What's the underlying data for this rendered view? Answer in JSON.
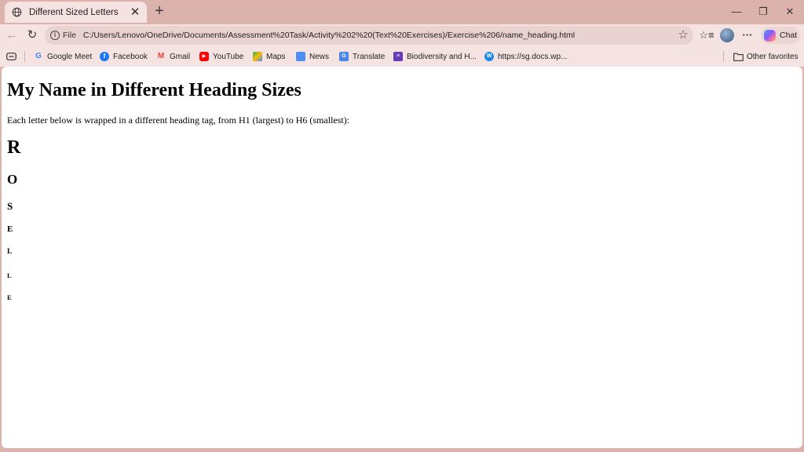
{
  "tab": {
    "title": "Different Sized Letters",
    "close_glyph": "✕",
    "icon": "globe-icon"
  },
  "new_tab_glyph": "+",
  "window_controls": {
    "minimize": "—",
    "restore": "❐",
    "close": "✕"
  },
  "toolbar": {
    "back_glyph": "←",
    "refresh_glyph": "↻",
    "scheme": "File",
    "url": "C:/Users/Lenovo/OneDrive/Documents/Assessment%20Task/Activity%202%20(Text%20Exercises)/Exercise%206/name_heading.html",
    "favorite_glyph": "☆",
    "favorites_glyph": "☆≡",
    "more_glyph": "···",
    "chat_label": "Chat"
  },
  "favorites": [
    {
      "label": "Google Meet",
      "icon": "google-icon",
      "color": "#4285f4"
    },
    {
      "label": "Facebook",
      "icon": "facebook-icon",
      "color": "#1877f2"
    },
    {
      "label": "Gmail",
      "icon": "gmail-icon",
      "color": "#ea4335"
    },
    {
      "label": "YouTube",
      "icon": "youtube-icon",
      "color": "#ff0000"
    },
    {
      "label": "Maps",
      "icon": "maps-icon",
      "color": "#34a853"
    },
    {
      "label": "News",
      "icon": "news-icon",
      "color": "#4f8ef7"
    },
    {
      "label": "Translate",
      "icon": "translate-icon",
      "color": "#4a86e8"
    },
    {
      "label": "Biodiversity and H...",
      "icon": "biodiversity-icon",
      "color": "#673ab7"
    },
    {
      "label": "https://sg.docs.wp...",
      "icon": "docs-icon",
      "color": "#1e88e5"
    }
  ],
  "other_favorites": "Other favorites",
  "page": {
    "heading": "My Name in Different Heading Sizes",
    "intro": "Each letter below is wrapped in a different heading tag, from H1 (largest) to H6 (smallest):",
    "letters": [
      "R",
      "O",
      "S",
      "E",
      "L",
      "L",
      "E"
    ]
  },
  "colors": {
    "frame": "#dcb2ad",
    "toolbar": "#f4e3e1",
    "address_bar": "#e9d3d1"
  }
}
